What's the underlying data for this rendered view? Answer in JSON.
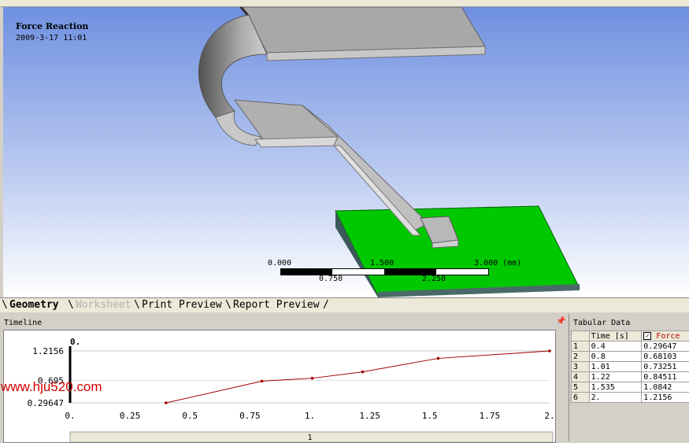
{
  "viewport": {
    "title": "Force Reaction",
    "date": "2009-3-17 11:01",
    "scale": {
      "top_labels": [
        "0.000",
        "1.500",
        "3.000 (mm)"
      ],
      "bottom_labels": [
        "0.750",
        "2.250"
      ]
    }
  },
  "tabs": [
    {
      "label": "Geometry",
      "state": "active"
    },
    {
      "label": "Worksheet",
      "state": "disabled"
    },
    {
      "label": "Print Preview",
      "state": "normal"
    },
    {
      "label": "Report Preview",
      "state": "normal"
    }
  ],
  "timeline": {
    "title": "Timeline",
    "marker_label": "0.",
    "footer_label": "1"
  },
  "chart_data": {
    "type": "line",
    "series": [
      {
        "x": [
          0.4,
          0.8,
          1.01,
          1.22,
          1.535,
          2.0
        ],
        "y": [
          0.29647,
          0.68103,
          0.73251,
          0.84511,
          1.0842,
          1.2156
        ]
      }
    ],
    "xlim": [
      0,
      2.0
    ],
    "ylim": [
      0.29647,
      1.2156
    ],
    "x_ticks": [
      "0.",
      "0.25",
      "0.5",
      "0.75",
      "1.",
      "1.25",
      "1.5",
      "1.75",
      "2."
    ],
    "y_ticks": [
      "1.2156",
      "0.695",
      "0.29647"
    ],
    "line_color": "#a00000"
  },
  "tabular": {
    "title": "Tabular Data",
    "headers": [
      "Time [s]",
      "Force"
    ],
    "rows": [
      [
        "1",
        "0.4",
        "0.29647"
      ],
      [
        "2",
        "0.8",
        "0.68103"
      ],
      [
        "3",
        "1.01",
        "0.73251"
      ],
      [
        "4",
        "1.22",
        "0.84511"
      ],
      [
        "5",
        "1.535",
        "1.0842"
      ],
      [
        "6",
        "2.",
        "1.2156"
      ]
    ]
  },
  "watermark": "www.hju520.com",
  "icons": {
    "pin": "pin-icon",
    "check": "checkbox-checked-icon"
  },
  "colors": {
    "board": "#00c000",
    "viewport_top": "#7f9ee6",
    "viewport_bottom": "#ffffff"
  }
}
